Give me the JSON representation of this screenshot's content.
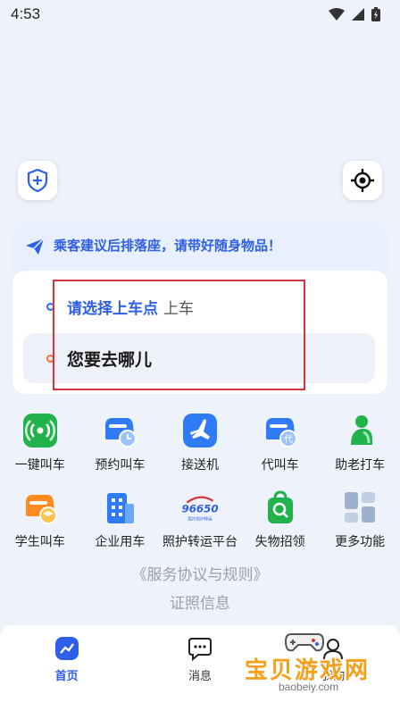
{
  "status_bar": {
    "time": "4:53"
  },
  "tip": {
    "text": "乘客建议后排落座，请带好随身物品！"
  },
  "route": {
    "pickup_label": "请选择上车点",
    "pickup_suffix": "上车",
    "destination_placeholder": "您要去哪儿"
  },
  "services": {
    "row1": [
      {
        "label": "一键叫车",
        "icon": "signal-car-icon"
      },
      {
        "label": "预约叫车",
        "icon": "clock-car-icon"
      },
      {
        "label": "接送机",
        "icon": "airplane-icon"
      },
      {
        "label": "代叫车",
        "icon": "proxy-car-icon"
      },
      {
        "label": "助老打车",
        "icon": "elder-icon"
      }
    ],
    "row2": [
      {
        "label": "学生叫车",
        "icon": "student-car-icon"
      },
      {
        "label": "企业用车",
        "icon": "building-icon"
      },
      {
        "label": "照护转运平台",
        "icon": "care-transport-logo",
        "logo_number": "96650",
        "logo_sub": "医疗照护转运"
      },
      {
        "label": "失物招领",
        "icon": "lost-found-icon"
      },
      {
        "label": "更多功能",
        "icon": "more-grid-icon"
      }
    ]
  },
  "footer": {
    "agreement": "《服务协议与规则》",
    "license": "证照信息"
  },
  "tabbar": {
    "tabs": [
      {
        "label": "首页",
        "icon": "home-trend-icon",
        "active": true
      },
      {
        "label": "消息",
        "icon": "message-icon",
        "active": false
      },
      {
        "label": "我的",
        "icon": "profile-icon",
        "active": false
      }
    ]
  },
  "watermark": {
    "text": "宝贝游戏网",
    "url": "baobeiy.com"
  },
  "colors": {
    "accent": "#2f5fe8",
    "tip_bg": "#e8efff",
    "highlight_frame": "#d6343c",
    "watermark": "#f5a01a"
  }
}
